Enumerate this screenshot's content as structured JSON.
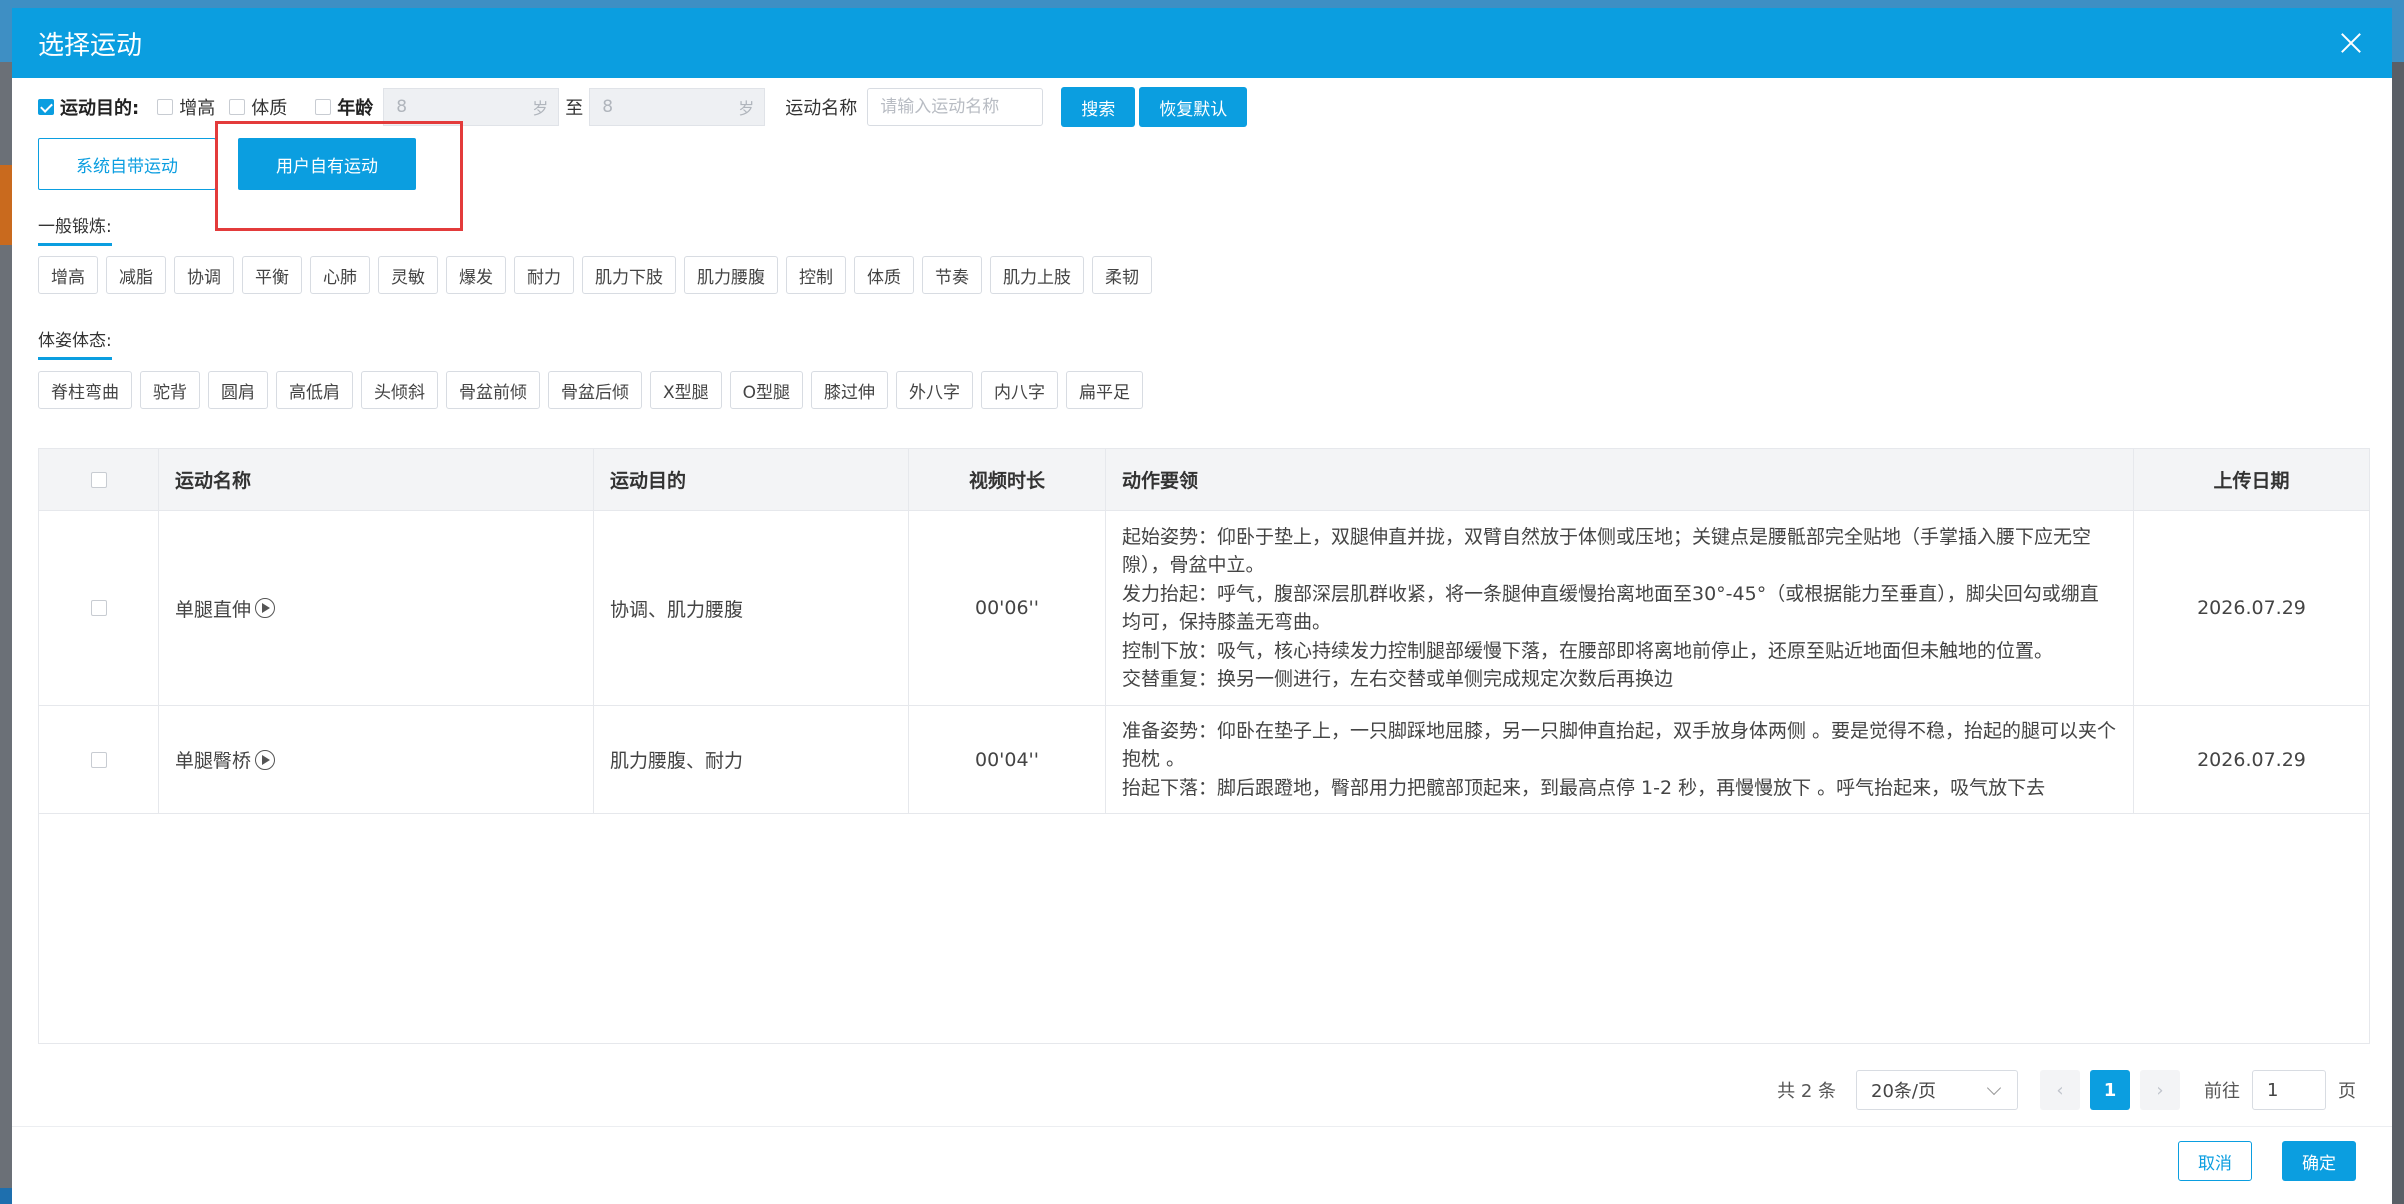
{
  "dialog": {
    "title": "选择运动"
  },
  "filters": {
    "purpose_label": "运动目的:",
    "options": [
      "增高",
      "体质"
    ],
    "age_label": "年龄",
    "age_from": "8",
    "age_to": "8",
    "age_unit": "岁",
    "to_label": "至",
    "name_label": "运动名称",
    "name_placeholder": "请输入运动名称",
    "search_label": "搜索",
    "reset_label": "恢复默认"
  },
  "source_tabs": {
    "system": "系统自带运动",
    "user": "用户自有运动"
  },
  "general": {
    "title": "一般锻炼:",
    "tags": [
      "增高",
      "减脂",
      "协调",
      "平衡",
      "心肺",
      "灵敏",
      "爆发",
      "耐力",
      "肌力下肢",
      "肌力腰腹",
      "控制",
      "体质",
      "节奏",
      "肌力上肢",
      "柔韧"
    ]
  },
  "posture": {
    "title": "体姿体态:",
    "tags": [
      "脊柱弯曲",
      "驼背",
      "圆肩",
      "高低肩",
      "头倾斜",
      "骨盆前倾",
      "骨盆后倾",
      "X型腿",
      "O型腿",
      "膝过伸",
      "外八字",
      "内八字",
      "扁平足"
    ]
  },
  "table": {
    "headers": [
      "运动名称",
      "运动目的",
      "视频时长",
      "动作要领",
      "上传日期"
    ],
    "rows": [
      {
        "name": "单腿直伸",
        "purpose": "协调、肌力腰腹",
        "duration": "00'06''",
        "steps": [
          "起始姿势：仰卧于垫上，双腿伸直并拢，双臂自然放于体侧或压地；关键点是腰骶部完全贴地（手掌插入腰下应无空隙），骨盆中立。",
          "发力抬起：呼气，腹部深层肌群收紧，将一条腿伸直缓慢抬离地面至30°-45°（或根据能力至垂直），脚尖回勾或绷直均可，保持膝盖无弯曲。",
          "控制下放：吸气，核心持续发力控制腿部缓慢下落，在腰部即将离地前停止，还原至贴近地面但未触地的位置。",
          "交替重复：换另一侧进行，左右交替或单侧完成规定次数后再换边"
        ],
        "date": "2026.07.29"
      },
      {
        "name": "单腿臀桥",
        "purpose": "肌力腰腹、耐力",
        "duration": "00'04''",
        "steps": [
          "准备姿势：仰卧在垫子上，一只脚踩地屈膝，另一只脚伸直抬起，双手放身体两侧 。要是觉得不稳，抬起的腿可以夹个抱枕 。",
          "抬起下落：脚后跟蹬地，臀部用力把髋部顶起来，到最高点停 1-2 秒，再慢慢放下 。呼气抬起来，吸气放下去"
        ],
        "date": "2026.07.29"
      }
    ]
  },
  "pagination": {
    "total": "共 2 条",
    "page_size": "20条/页",
    "prev": "‹",
    "current": "1",
    "next": "›",
    "goto_label": "前往",
    "goto_value": "1",
    "page_suffix": "页"
  },
  "footer": {
    "cancel": "取消",
    "confirm": "确定"
  },
  "colors": {
    "primary": "#0b9ee0",
    "highlight": "#e33b3b"
  }
}
